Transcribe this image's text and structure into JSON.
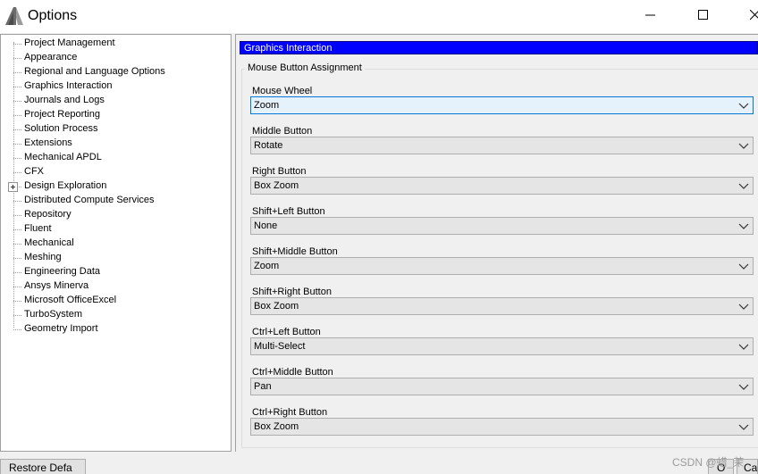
{
  "window": {
    "title": "Options",
    "logo_icon": "ansys-logo-icon",
    "controls": [
      "minimize-icon",
      "maximize-icon",
      "close-icon"
    ]
  },
  "tree": {
    "items": [
      {
        "label": "Project Management",
        "expandable": false
      },
      {
        "label": "Appearance",
        "expandable": false
      },
      {
        "label": "Regional and Language Options",
        "expandable": false
      },
      {
        "label": "Graphics Interaction",
        "expandable": false
      },
      {
        "label": "Journals and Logs",
        "expandable": false
      },
      {
        "label": "Project Reporting",
        "expandable": false
      },
      {
        "label": "Solution Process",
        "expandable": false
      },
      {
        "label": "Extensions",
        "expandable": false
      },
      {
        "label": "Mechanical APDL",
        "expandable": false
      },
      {
        "label": "CFX",
        "expandable": false
      },
      {
        "label": "Design Exploration",
        "expandable": true
      },
      {
        "label": "Distributed Compute Services",
        "expandable": false
      },
      {
        "label": "Repository",
        "expandable": false
      },
      {
        "label": "Fluent",
        "expandable": false
      },
      {
        "label": "Mechanical",
        "expandable": false
      },
      {
        "label": "Meshing",
        "expandable": false
      },
      {
        "label": "Engineering Data",
        "expandable": false
      },
      {
        "label": "Ansys Minerva",
        "expandable": false
      },
      {
        "label": "Microsoft OfficeExcel",
        "expandable": false
      },
      {
        "label": "TurboSystem",
        "expandable": false
      },
      {
        "label": "Geometry Import",
        "expandable": false
      }
    ]
  },
  "panel": {
    "header": "Graphics Interaction",
    "group_title": "Mouse Button Assignment",
    "fields": [
      {
        "label": "Mouse Wheel",
        "value": "Zoom"
      },
      {
        "label": "Middle Button",
        "value": "Rotate"
      },
      {
        "label": "Right Button",
        "value": "Box Zoom"
      },
      {
        "label": "Shift+Left Button",
        "value": "None"
      },
      {
        "label": "Shift+Middle Button",
        "value": "Zoom"
      },
      {
        "label": "Shift+Right Button",
        "value": "Box Zoom"
      },
      {
        "label": "Ctrl+Left Button",
        "value": "Multi-Select"
      },
      {
        "label": "Ctrl+Middle Button",
        "value": "Pan"
      },
      {
        "label": "Ctrl+Right Button",
        "value": "Box Zoom"
      }
    ]
  },
  "buttons": {
    "restore_defaults": "Restore Defa",
    "ok": "O",
    "cancel": "Ca"
  },
  "watermark": "CSDN @蜡_茉",
  "colors": {
    "header_bg": "#0000ff",
    "header_text": "#ffffff",
    "focus_border": "#0078d7"
  }
}
